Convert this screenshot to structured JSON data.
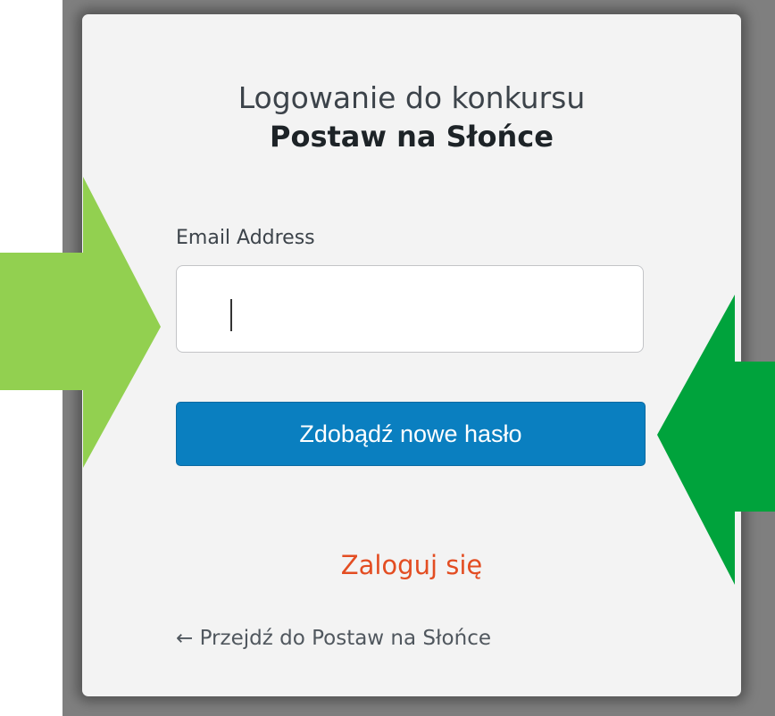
{
  "login_card": {
    "title_line1": "Logowanie do konkursu",
    "title_line2": "Postaw na Słońce",
    "email_label": "Email Address",
    "email_value": "",
    "submit_label": "Zdobądź nowe hasło",
    "login_link": "Zaloguj się",
    "back_link": "← Przejdź do Postaw na Słońce"
  },
  "colors": {
    "submit_button": "#0a7fc0",
    "login_link": "#e34d22",
    "left_arrow": "#92d050",
    "right_arrow": "#00a33c"
  },
  "annotations": {
    "left_arrow_icon": "arrow-right-icon",
    "right_arrow_icon": "arrow-left-icon"
  }
}
